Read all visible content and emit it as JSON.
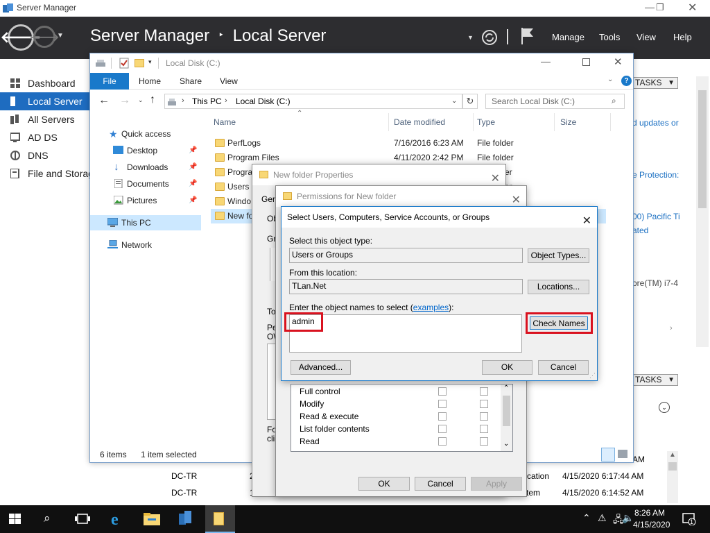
{
  "server_manager": {
    "window_title": "Server Manager",
    "breadcrumb_app": "Server Manager",
    "breadcrumb_sep": "‣",
    "breadcrumb_page": "Local Server",
    "menus": [
      "Manage",
      "Tools",
      "View",
      "Help"
    ],
    "sidebar": [
      {
        "label": "Dashboard",
        "icon": "dashboard-icon"
      },
      {
        "label": "Local Server",
        "icon": "server-icon",
        "active": true
      },
      {
        "label": "All Servers",
        "icon": "servers-icon"
      },
      {
        "label": "AD DS",
        "icon": "ad-ds-icon"
      },
      {
        "label": "DNS",
        "icon": "dns-icon"
      },
      {
        "label": "File and Storag",
        "icon": "storage-icon"
      }
    ],
    "tasks_label": "TASKS",
    "right_fragments": [
      "d updates or",
      "e Protection:",
      "00) Pacific Ti",
      "ated",
      "ore(TM) i7-4"
    ],
    "events": [
      {
        "server": "DC-TR",
        "id": "2",
        "source": "plication",
        "date": "4/15/2020 6:17:44 AM"
      },
      {
        "server": "DC-TR",
        "id": "1",
        "source": "tem",
        "date": "4/15/2020 6:14:52 AM"
      }
    ],
    "prev_row_date_fragment": "AM"
  },
  "explorer": {
    "title": "Local Disk (C:)",
    "ribbon_tabs": [
      "File",
      "Home",
      "Share",
      "View"
    ],
    "address": [
      "This PC",
      "Local Disk (C:)"
    ],
    "search_placeholder": "Search Local Disk (C:)",
    "nav": [
      {
        "label": "Quick access",
        "icon": "star-icon"
      },
      {
        "label": "Desktop",
        "icon": "desktop-icon",
        "pinned": true
      },
      {
        "label": "Downloads",
        "icon": "downloads-icon",
        "pinned": true
      },
      {
        "label": "Documents",
        "icon": "documents-icon",
        "pinned": true
      },
      {
        "label": "Pictures",
        "icon": "pictures-icon",
        "pinned": true
      },
      {
        "label": "This PC",
        "icon": "computer-icon",
        "selected": true
      },
      {
        "label": "Network",
        "icon": "network-icon"
      }
    ],
    "columns": [
      "Name",
      "Date modified",
      "Type",
      "Size"
    ],
    "files": [
      {
        "name": "PerfLogs",
        "date": "7/16/2016 6:23 AM",
        "type": "File folder"
      },
      {
        "name": "Program Files",
        "date": "4/11/2020 2:42 PM",
        "type": "File folder"
      },
      {
        "name": "Progra",
        "date": "",
        "type": "er"
      },
      {
        "name": "Users",
        "date": "",
        "type": "er"
      },
      {
        "name": "Windo",
        "date": "",
        "type": ""
      },
      {
        "name": "New fo",
        "date": "",
        "type": "",
        "selected": true
      }
    ],
    "status_items": "6 items",
    "status_selected": "1 item selected"
  },
  "properties_dialog": {
    "title": "New folder Properties",
    "fragments": [
      "Gen",
      "Ob",
      "Gro",
      "To",
      "Pe",
      "OW",
      "Fo",
      "clic"
    ],
    "ok": "OK",
    "cancel": "Cancel",
    "apply": "Apply"
  },
  "permissions_dialog": {
    "title": "Permissions for New folder",
    "permissions": [
      "Full control",
      "Modify",
      "Read & execute",
      "List folder contents",
      "Read"
    ]
  },
  "select_dialog": {
    "title": "Select Users, Computers, Service Accounts, or Groups",
    "object_type_label": "Select this object type:",
    "object_type_value": "Users or Groups",
    "object_types_button": "Object Types...",
    "location_label": "From this location:",
    "location_value": "TLan.Net",
    "locations_button": "Locations...",
    "names_label": "Enter the object names to select (",
    "names_link": "examples",
    "names_label_end": "):",
    "names_value": "admin",
    "check_names_button": "Check Names",
    "advanced_button": "Advanced...",
    "ok_button": "OK",
    "cancel_button": "Cancel",
    "highlight_color": "#d9121f"
  },
  "taskbar": {
    "time": "8:26 AM",
    "date": "4/15/2020",
    "notification_count": "1"
  }
}
